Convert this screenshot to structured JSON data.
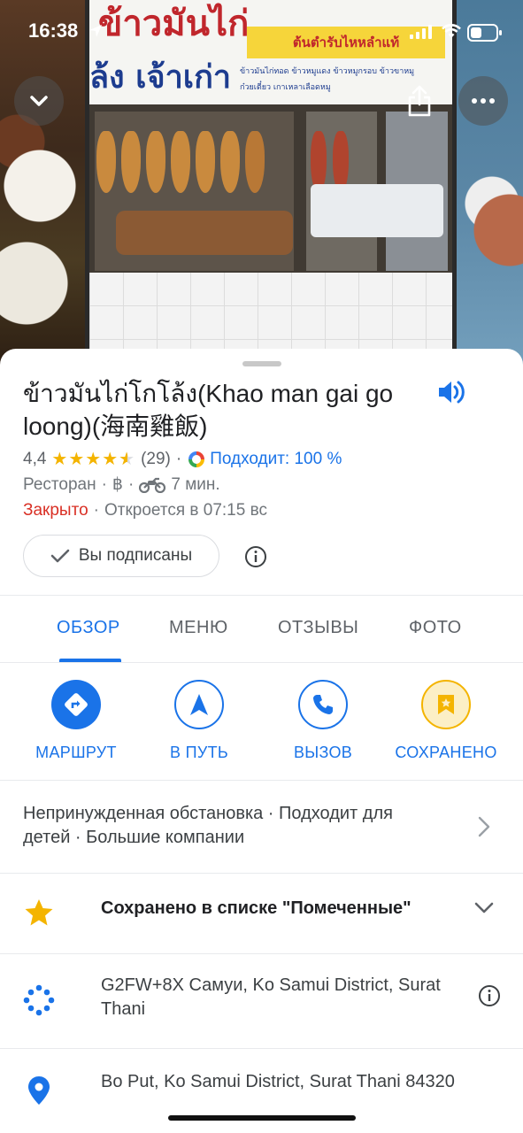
{
  "status_bar": {
    "time": "16:38"
  },
  "photo": {
    "sign_line1": "ข้าวมันไก่",
    "sign_line2": "ล้ง เจ้าเก่า",
    "sign_box": "ต้นตำรับไหหลำแท้",
    "sign_small": "ข้าวมันไก่ทอด ข้าวหมูแดง ข้าวหมูกรอบ ข้าวขาหมู ก๋วยเตี๋ยว เกาเหลาเลือดหมู"
  },
  "place": {
    "name": "ข้าวมันไก่โกโล้ง(Khao man gai go loong)(海南雞飯)",
    "rating": "4,4",
    "reviews_count": "(29)",
    "match": "Подходит: 100 %",
    "category": "Ресторан",
    "price": "฿",
    "travel_time": "7 мин.",
    "status_closed": "Закрыто",
    "opens": "Откроется в 07:15 вс",
    "follow_label": "Вы подписаны"
  },
  "tabs": [
    "ОБЗОР",
    "МЕНЮ",
    "ОТЗЫВЫ",
    "ФОТО"
  ],
  "actions": {
    "route": "МАРШРУТ",
    "go": "В ПУТЬ",
    "call": "ВЫЗОВ",
    "saved": "СОХРАНЕНО"
  },
  "details": {
    "highlights": "Непринужденная обстановка · Подходит для детей · Большие компании",
    "saved_list": "Сохранено в списке \"Помеченные\"",
    "plus_code": "G2FW+8X Самуи, Ko Samui District, Surat Thani",
    "address": "Bo Put, Ko Samui District, Surat Thani 84320"
  },
  "colors": {
    "accent": "#1a73e8",
    "star": "#f4b400",
    "closed": "#d93025"
  }
}
